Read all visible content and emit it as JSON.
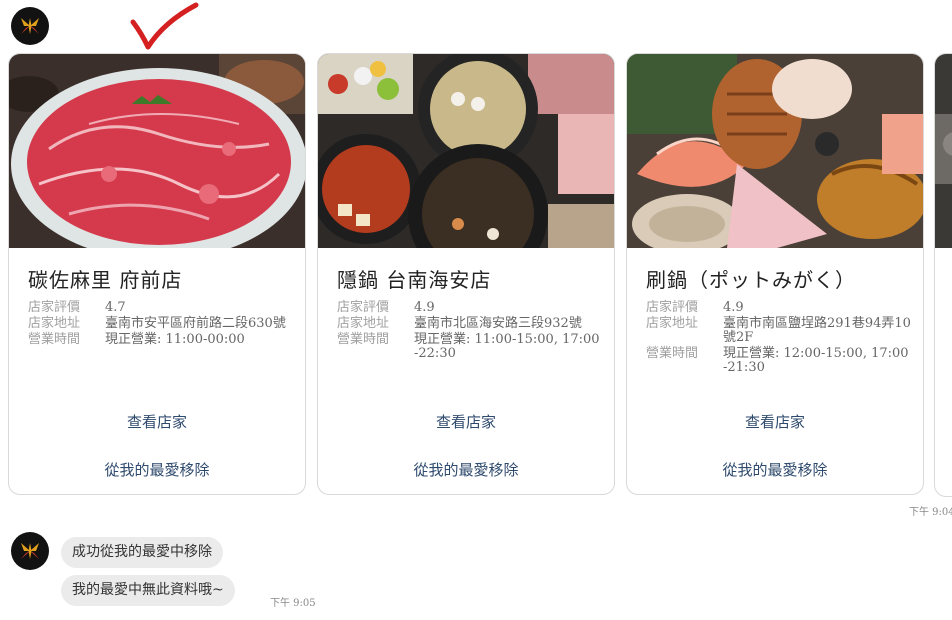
{
  "cards": [
    {
      "title": "碳佐麻里 府前店",
      "rows": [
        {
          "label": "店家評價",
          "value": "4.7"
        },
        {
          "label": "店家地址",
          "value": "臺南市安平區府前路二段630號"
        },
        {
          "label": "營業時間",
          "value": "現正營業: 11:00-00:00"
        }
      ],
      "view_label": "查看店家",
      "remove_label": "從我的最愛移除"
    },
    {
      "title": "隱鍋 台南海安店",
      "rows": [
        {
          "label": "店家評價",
          "value": "4.9"
        },
        {
          "label": "店家地址",
          "value": "臺南市北區海安路三段932號"
        },
        {
          "label": "營業時間",
          "value": "現正營業: 11:00-15:00, 17:00-22:30"
        }
      ],
      "view_label": "查看店家",
      "remove_label": "從我的最愛移除"
    },
    {
      "title": "刷鍋（ポットみがく）",
      "rows": [
        {
          "label": "店家評價",
          "value": "4.9"
        },
        {
          "label": "店家地址",
          "value": "臺南市南區鹽埕路291巷94弄10號2F"
        },
        {
          "label": "營業時間",
          "value": "現正營業: 12:00-15:00, 17:00-21:30"
        }
      ],
      "view_label": "查看店家",
      "remove_label": "從我的最愛移除"
    }
  ],
  "carousel_time": "下午 9:04",
  "messages": [
    {
      "text": "成功從我的最愛中移除"
    },
    {
      "text": "我的最愛中無此資料哦~"
    }
  ],
  "messages_time": "下午 9:05",
  "colors": {
    "link": "#2e4a6d",
    "bubble": "#ebebeb",
    "check_mark": "#d42020"
  },
  "icons": {
    "avatar": "bot-logo-icon",
    "annotation": "checkmark-icon"
  }
}
